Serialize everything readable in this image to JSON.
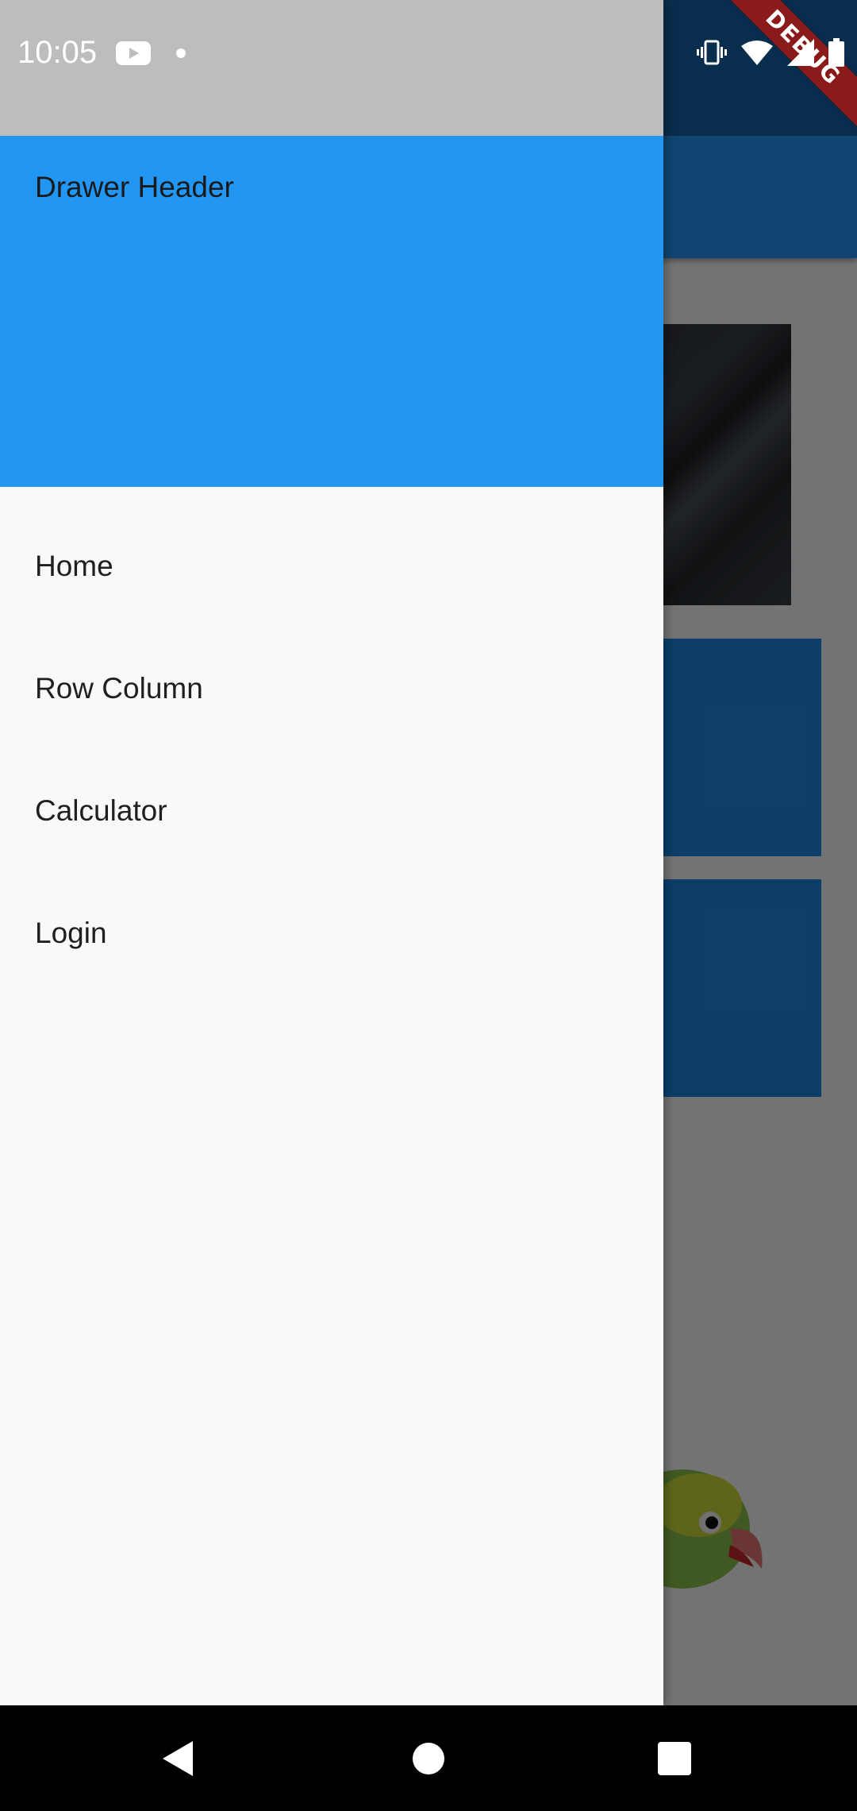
{
  "status_bar": {
    "time": "10:05",
    "icons": [
      "youtube-icon",
      "notification-dot-icon",
      "vibrate-icon",
      "wifi-icon",
      "signal-icon",
      "battery-icon"
    ]
  },
  "debug_banner": {
    "label": "DEBUG"
  },
  "drawer": {
    "header_title": "Drawer Header",
    "items": [
      {
        "label": "Home"
      },
      {
        "label": "Row Column"
      },
      {
        "label": "Calculator"
      },
      {
        "label": "Login"
      }
    ]
  },
  "navigation_bar": {
    "icons": [
      "back-icon",
      "home-icon",
      "recents-icon"
    ]
  },
  "colors": {
    "drawer_header": "#2196f3",
    "drawer_background": "#f9f9f9",
    "app_bar": "#2196f3",
    "scrim": "rgba(0,0,0,0.54)",
    "debug_banner": "#8b1a1a"
  }
}
